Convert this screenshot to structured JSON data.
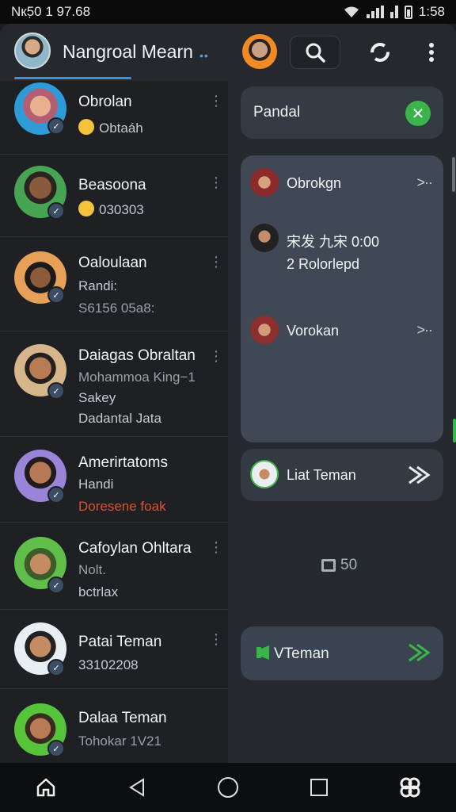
{
  "status": {
    "left": "Nк5̣0 1  97.68",
    "time": "1:58"
  },
  "header": {
    "title": "Nangroal Mearn",
    "dots": "••"
  },
  "chats": [
    {
      "name": "Obrolan",
      "line1": "Obtaáh",
      "line2": "",
      "line3": ""
    },
    {
      "name": "Beasoona",
      "line1": "030303",
      "line2": "",
      "line3": ""
    },
    {
      "name": "Oaloulaan",
      "line1": "Randi:",
      "line2": "S6156 05a8:",
      "line3": ""
    },
    {
      "name": "Daiagas Obraltan",
      "line1": "Mohammoa King−1",
      "line2": "Sakey",
      "line3": "Dadantal Jata"
    },
    {
      "name": "Amerirtatoms",
      "line1": "Handi",
      "line2": "Doresene foak",
      "line3": ""
    },
    {
      "name": "Cafoylan Ohltara",
      "line1": "Nolt.",
      "line2": "bctrlax",
      "line3": ""
    },
    {
      "name": "Patai Teman",
      "line1": "33102208",
      "line2": "",
      "line3": ""
    },
    {
      "name": "Dalaa Teman",
      "line1": "Tohokar 1V21",
      "line2": "",
      "line3": ""
    }
  ],
  "right": {
    "pandal": "Pandal",
    "items": [
      {
        "label": "Obrokgn",
        "chev": ">··"
      },
      {
        "label": "宋发 九宋 0:00",
        "sub": "2 Rolorlepd"
      },
      {
        "label": "Vorokan",
        "chev": ">··"
      }
    ],
    "liat": "Liat Teman",
    "counter": "50",
    "vteman": "VTeman"
  },
  "colors": {
    "accent": "#3d8fd8",
    "green": "#3ab54a",
    "orange": "#f08a22"
  },
  "icons": [
    "search-icon",
    "sync-icon",
    "more-icon",
    "home-icon",
    "back-icon",
    "circle-home-icon",
    "recents-icon",
    "app-logo-icon",
    "mic-icon",
    "close-icon"
  ]
}
